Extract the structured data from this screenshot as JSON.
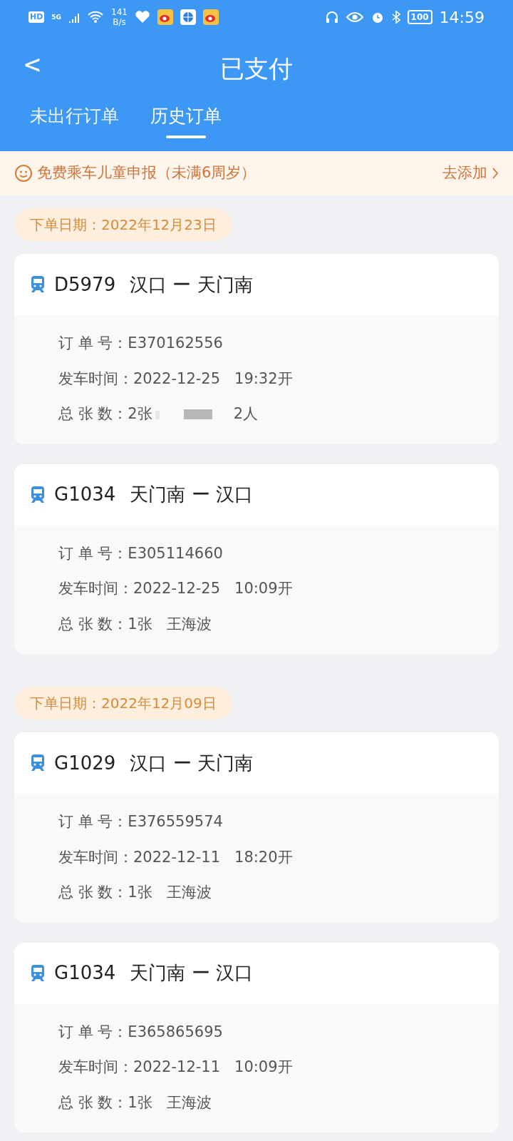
{
  "status_bar": {
    "hd": "HD",
    "network": "5G",
    "speed": "141",
    "speed_unit": "B/s",
    "battery": "100",
    "time": "14:59"
  },
  "header": {
    "back": "<",
    "title": "已支付"
  },
  "tabs": [
    {
      "label": "未出行订单",
      "selected": false
    },
    {
      "label": "历史订单",
      "selected": true
    }
  ],
  "notice": {
    "text": "免费乘车儿童申报（未满6周岁）",
    "action": "去添加"
  },
  "groups": [
    {
      "date": "下单日期：2022年12月23日",
      "orders": [
        {
          "train": "D5979",
          "from": "汉口",
          "separator": "ー",
          "to": "天门南",
          "order_label": "订 单 号：",
          "order_no": "E370162556",
          "depart_label": "发车时间：",
          "depart_date": "2022-12-25",
          "depart_time": "19:32开",
          "count_label": "总 张 数：",
          "count": "2张",
          "passenger": "2人",
          "redacted": true
        },
        {
          "train": "G1034",
          "from": "天门南",
          "separator": "ー",
          "to": "汉口",
          "order_label": "订 单 号：",
          "order_no": "E305114660",
          "depart_label": "发车时间：",
          "depart_date": "2022-12-25",
          "depart_time": "10:09开",
          "count_label": "总 张 数：",
          "count": "1张",
          "passenger": "王海波",
          "redacted": false
        }
      ]
    },
    {
      "date": "下单日期：2022年12月09日",
      "orders": [
        {
          "train": "G1029",
          "from": "汉口",
          "separator": "ー",
          "to": "天门南",
          "order_label": "订 单 号：",
          "order_no": "E376559574",
          "depart_label": "发车时间：",
          "depart_date": "2022-12-11",
          "depart_time": "18:20开",
          "count_label": "总 张 数：",
          "count": "1张",
          "passenger": "王海波",
          "redacted": false
        },
        {
          "train": "G1034",
          "from": "天门南",
          "separator": "ー",
          "to": "汉口",
          "order_label": "订 单 号：",
          "order_no": "E365865695",
          "depart_label": "发车时间：",
          "depart_date": "2022-12-11",
          "depart_time": "10:09开",
          "count_label": "总 张 数：",
          "count": "1张",
          "passenger": "王海波",
          "redacted": false
        }
      ]
    }
  ]
}
